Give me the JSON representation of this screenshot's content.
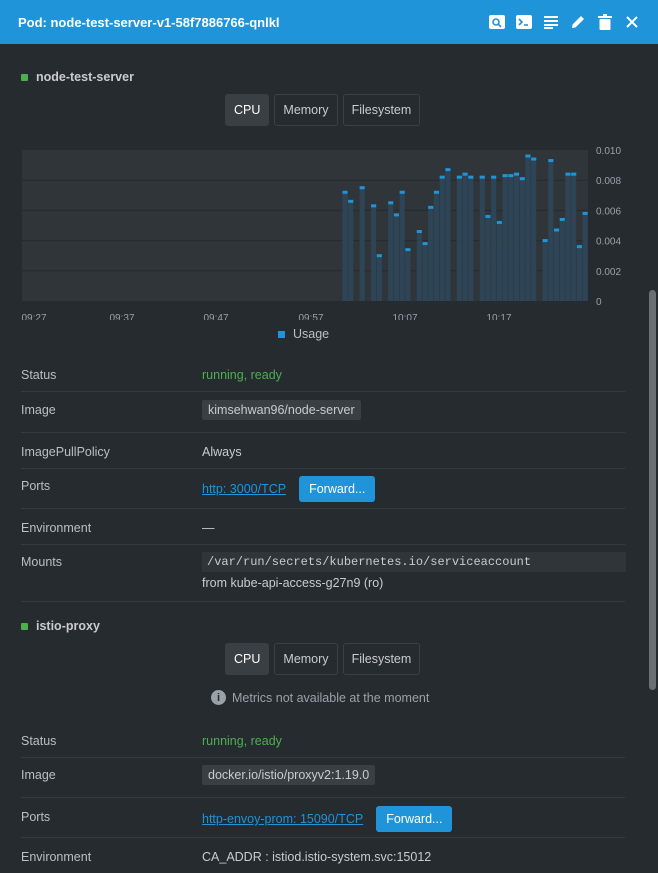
{
  "window": {
    "title": "Pod: node-test-server-v1-58f7886766-qnlkl",
    "actions": [
      "search-logs-icon",
      "terminal-icon",
      "logs-icon",
      "edit-icon",
      "delete-icon",
      "close-icon"
    ]
  },
  "container1": {
    "name": "node-test-server",
    "tabs": [
      "CPU",
      "Memory",
      "Filesystem"
    ],
    "active_tab": "CPU",
    "legend": "Usage",
    "status_label": "Status",
    "status": "running, ready",
    "image_label": "Image",
    "image": "kimsehwan96/node-server",
    "pull_label": "ImagePullPolicy",
    "pull": "Always",
    "ports_label": "Ports",
    "port_link": "http: 3000/TCP",
    "forward": "Forward...",
    "env_label": "Environment",
    "env": "—",
    "mounts_label": "Mounts",
    "mount_path": "/var/run/secrets/kubernetes.io/serviceaccount",
    "mount_from": "from kube-api-access-g27n9 (ro)"
  },
  "container2": {
    "name": "istio-proxy",
    "tabs": [
      "CPU",
      "Memory",
      "Filesystem"
    ],
    "active_tab": "CPU",
    "notice": "Metrics not available at the moment",
    "status_label": "Status",
    "status": "running, ready",
    "image_label": "Image",
    "image": "docker.io/istio/proxyv2:1.19.0",
    "ports_label": "Ports",
    "port_link": "http-envoy-prom: 15090/TCP",
    "forward": "Forward...",
    "env_label": "Environment",
    "env": "CA_ADDR : istiod.istio-system.svc:15012"
  },
  "chart_data": {
    "type": "bar",
    "x_ticks": [
      "09:27",
      "09:37",
      "09:47",
      "09:57",
      "10:07",
      "10:17"
    ],
    "y_ticks": [
      "0.010",
      "0.008",
      "0.006",
      "0.004",
      "0.002",
      "0"
    ],
    "ylim": [
      0,
      0.01
    ],
    "series": [
      {
        "name": "Usage",
        "values": [
          0,
          0,
          0,
          0,
          0,
          0,
          0,
          0,
          0,
          0,
          0,
          0,
          0,
          0,
          0,
          0,
          0,
          0,
          0,
          0,
          0,
          0,
          0,
          0,
          0,
          0,
          0,
          0,
          0,
          0,
          0,
          0,
          0,
          0,
          0,
          0,
          0,
          0,
          0,
          0,
          0,
          0,
          0,
          0,
          0,
          0,
          0,
          0,
          0,
          0,
          0,
          0,
          0,
          0,
          0,
          0,
          0.0073,
          0.0067,
          0,
          0.0076,
          0,
          0.0064,
          0.0031,
          0,
          0.0066,
          0.0058,
          0.0073,
          0.0035,
          0,
          0.0047,
          0.0039,
          0.0063,
          0.0073,
          0.0083,
          0.0088,
          0,
          0.0083,
          0.0085,
          0.0083,
          0,
          0.0083,
          0.0057,
          0.0083,
          0.0053,
          0.0084,
          0.0084,
          0.0085,
          0.0082,
          0.0097,
          0.0095,
          0,
          0.0041,
          0.0094,
          0.0048,
          0.0055,
          0.0085,
          0.0085,
          0.0037,
          0.0059
        ]
      }
    ],
    "grid": true
  }
}
